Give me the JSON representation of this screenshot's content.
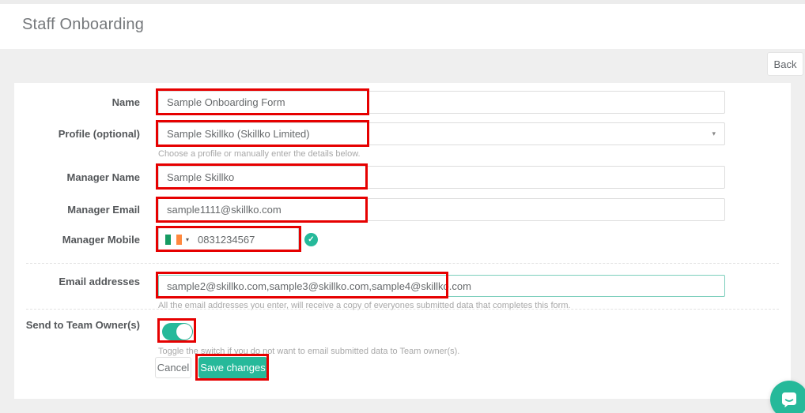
{
  "page": {
    "title": "Staff Onboarding"
  },
  "toolbar": {
    "back_label": "Back"
  },
  "form": {
    "name": {
      "label": "Name",
      "value": "Sample Onboarding Form"
    },
    "profile": {
      "label": "Profile (optional)",
      "value": "Sample Skillko (Skillko Limited)",
      "help": "Choose a profile or manually enter the details below."
    },
    "manager_name": {
      "label": "Manager Name",
      "value": "Sample Skillko"
    },
    "manager_email": {
      "label": "Manager Email",
      "value": "sample1111@skillko.com"
    },
    "manager_mobile": {
      "label": "Manager Mobile",
      "value": "0831234567",
      "country": "Ireland",
      "valid": "yes"
    },
    "email_addresses": {
      "label": "Email addresses",
      "value": "sample2@skillko.com,sample3@skillko.com,sample4@skillko.com",
      "help": "All the email addresses you enter, will receive a copy of everyones submitted data that completes this form."
    },
    "send_to_team_owners": {
      "label": "Send to Team Owner(s)",
      "state": "on",
      "help": "Toggle the switch if you do not want to email submitted data to Team owner(s)."
    },
    "actions": {
      "cancel_label": "Cancel",
      "save_label": "Save changes"
    }
  },
  "icons": {
    "valid_check": "✓"
  },
  "colors": {
    "accent": "#26b99a",
    "annotation_red": "#e60000",
    "email_input_border": "#7ccfbc",
    "flag_green": "#169b62",
    "flag_orange": "#ff883e"
  }
}
